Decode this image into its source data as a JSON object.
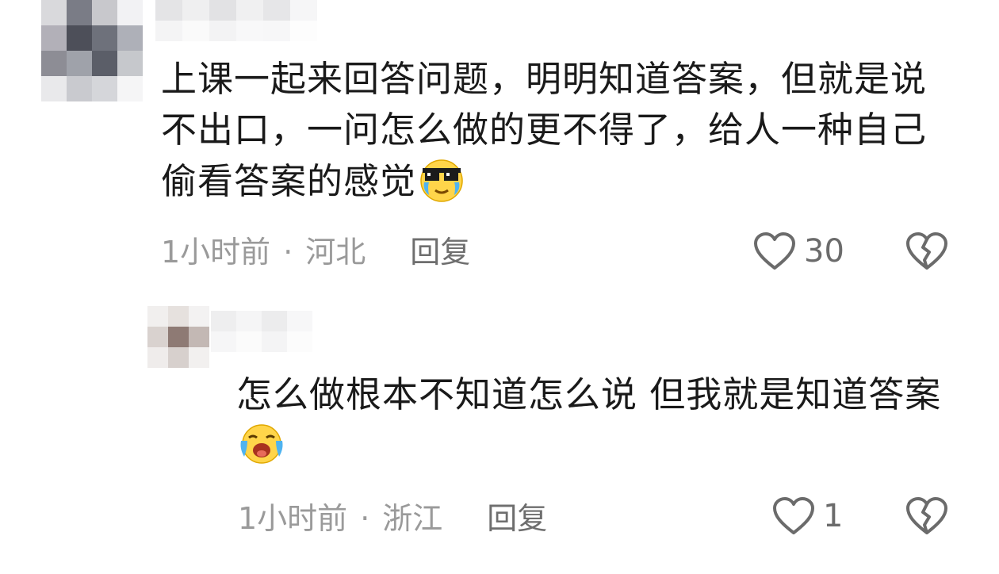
{
  "comments": [
    {
      "text": "上课一起来回答问题，明明知道答案，但就是说不出口，一问怎么做的更不得了，给人一种自己偷看答案的感觉",
      "emoji": "cool-crying-emoji",
      "time": "1小时前",
      "separator": "·",
      "location": "河北",
      "reply_label": "回复",
      "likes": "30"
    },
    {
      "text": "怎么做根本不知道怎么说 但我就是知道答案",
      "emoji": "loudly-crying-emoji",
      "time": "1小时前",
      "separator": "·",
      "location": "浙江",
      "reply_label": "回复",
      "likes": "1"
    }
  ],
  "colors": {
    "text": "#1a1a1a",
    "meta": "#9a9a9a",
    "icon": "#6b6b6b"
  }
}
